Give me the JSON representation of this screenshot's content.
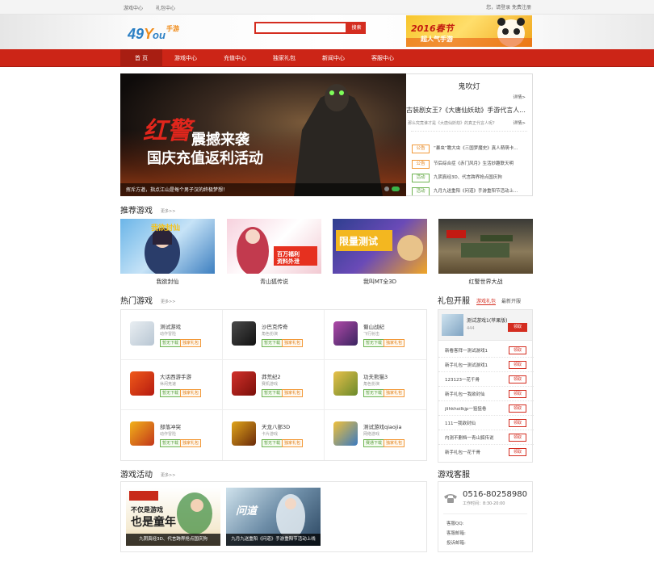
{
  "topbar": {
    "links": [
      "游戏中心",
      "礼包中心"
    ],
    "user_text": "您，请登录 免费注册"
  },
  "header": {
    "logo_text": "49You",
    "logo_sub": "手游",
    "search_placeholder": "",
    "search_button": "搜索",
    "ad_text1": "2016春节",
    "ad_text2": "超人气手游"
  },
  "nav": {
    "items": [
      "首 页",
      "游戏中心",
      "充值中心",
      "独家礼包",
      "新闻中心",
      "客服中心"
    ]
  },
  "slider": {
    "title1": "红警",
    "title2": "震撼来袭",
    "subtitle": "国庆充值返利活动",
    "caption": "挥斥方遒，指点江山是每个男子汉的终极梦想！"
  },
  "news": {
    "heading": "鬼吹灯",
    "detail1": "详情>",
    "headline": "古装剧女王?《大唐仙妖劫》手游代言人...",
    "summary": "那么究竟谁才是《大唐仙妖劫》的真正代言人呢?",
    "detail2": "详情>",
    "items": [
      {
        "tag": "公告",
        "text": "“暴虫”瞻大虫《三国梦魔史》真人萌萌卡..."
      },
      {
        "tag": "公告",
        "text": "节后综合症《赤门风月》生活妙趣联天明"
      },
      {
        "tag": "活动",
        "text": "九阴真经3D、代言跨界抢点国庆狗"
      },
      {
        "tag": "活动",
        "text": "九月九送重阳《问道》手游重阳节活动上..."
      }
    ]
  },
  "recommend": {
    "title": "推荐游戏",
    "more": "更多>>",
    "games": [
      "我欲封仙",
      "青山狐传说",
      "我叫MT全3D",
      "红警世界大战"
    ]
  },
  "hot": {
    "title": "热门游戏",
    "more": "更多>>",
    "games": [
      {
        "name": "测试游戏",
        "type": "动作冒险",
        "b1": "暂无下载",
        "b2": "独家礼包"
      },
      {
        "name": "沙巴克传奇",
        "type": "角色扮演",
        "b1": "暂无下载",
        "b2": "独家礼包"
      },
      {
        "name": "蜀山战纪",
        "type": "飞行射击",
        "b1": "暂无下载",
        "b2": "独家礼包"
      },
      {
        "name": "大话西游手游",
        "type": "休闲竞速",
        "b1": "暂无下载",
        "b2": "独家礼包"
      },
      {
        "name": "莽荒纪2",
        "type": "赛机游戏",
        "b1": "暂无下载",
        "b2": "独家礼包"
      },
      {
        "name": "功夫熊猫3",
        "type": "角色扮演",
        "b1": "暂无下载",
        "b2": "独家礼包"
      },
      {
        "name": "部落冲突",
        "type": "动作冒险",
        "b1": "暂无下载",
        "b2": "独家礼包"
      },
      {
        "name": "天龙八部3D",
        "type": "卡片游戏",
        "b1": "暂无下载",
        "b2": "独家礼包"
      },
      {
        "name": "测试游戏qiaojia",
        "type": "网络游戏",
        "b1": "赛通下载",
        "b2": "独家礼包"
      }
    ]
  },
  "gift": {
    "title": "礼包开服",
    "tab1": "游戏礼包",
    "tab2": "最新开服",
    "featured_name": "测试游戏1(苹果版)",
    "featured_count": "444",
    "featured_button": "领取",
    "rows": [
      {
        "text": "新看客拜一测试游戏1",
        "btn": "领取"
      },
      {
        "text": "新手礼包一测试游戏1",
        "btn": "领取"
      },
      {
        "text": "123123一花千骨",
        "btn": "领取"
      },
      {
        "text": "新手礼包一我欲封仙",
        "btn": "领取"
      },
      {
        "text": "jlihkhoilkjp一狙狙卷",
        "btn": "领取"
      },
      {
        "text": "111一我欲封仙",
        "btn": "领取"
      },
      {
        "text": "内测不删档一青山狐传说",
        "btn": "领取"
      },
      {
        "text": "新手礼包一花千骨",
        "btn": "领取"
      }
    ]
  },
  "activity": {
    "title": "游戏活动",
    "more": "更多>>",
    "items": [
      {
        "caption": "九阴真经3D、代言跨界抢点国庆狗",
        "art1": "不仅是游戏",
        "art2": "也是童年"
      },
      {
        "caption": "九月九送重阳《问道》手游重阳节活动上线",
        "art1": "问道",
        "art2": ""
      }
    ]
  },
  "service": {
    "title": "游戏客服",
    "phone": "0516-80258980",
    "hours": "工作时间：8:30-20:00",
    "qq": "客服QQ:",
    "email": "客服邮箱:",
    "complaint": "投诉邮箱:"
  }
}
